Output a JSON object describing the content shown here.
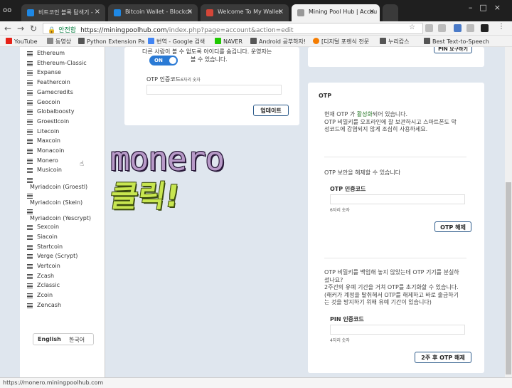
{
  "browser": {
    "tabs": [
      {
        "title": "비트코인 블록 탐색기 -",
        "color": "#1e88e5"
      },
      {
        "title": "Bitcoin Wallet - Blockch",
        "color": "#1e88e5"
      },
      {
        "title": "Welcome To My Wallet",
        "color": "#d44638"
      },
      {
        "title": "Mining Pool Hub | Accou",
        "color": "#999999"
      }
    ],
    "secure_label": "안전함",
    "url_host": "https://miningpoolhub.com",
    "url_path": "/index.php?page=account&action=edit",
    "bookmarks": [
      {
        "label": "YouTube",
        "color": "#e62117"
      },
      {
        "label": "동영상",
        "color": "#888888"
      },
      {
        "label": "Python Extension Pa",
        "color": "#555555"
      },
      {
        "label": "번역 - Google 검색",
        "color": "#4285f4"
      },
      {
        "label": "NAVER",
        "color": "#1ec800"
      },
      {
        "label": "Android 공부하자!",
        "color": "#555555"
      },
      {
        "label": "[디지털 포렌식 전문",
        "color": "#f57c00"
      },
      {
        "label": "누리캅스",
        "color": "#555555"
      },
      {
        "label": "Best Text-to-Speech",
        "color": "#555555"
      }
    ]
  },
  "sidebar": {
    "coins": [
      "Ethereum",
      "Ethereum-Classic",
      "Expanse",
      "Feathercoin",
      "Gamecredits",
      "Geocoin",
      "Globalboosty",
      "Groestlcoin",
      "Litecoin",
      "Maxcoin",
      "Monacoin",
      "Monero",
      "Musicoin",
      "Myriadcoin (Groestl)",
      "Myriadcoin (Skein)",
      "Myriadcoin (Yescrypt)",
      "Sexcoin",
      "Siacoin",
      "Startcoin",
      "Verge (Scrypt)",
      "Vertcoin",
      "Zcash",
      "Zclassic",
      "Zcoin",
      "Zencash"
    ],
    "lang_en": "English",
    "lang_ko": "한국어"
  },
  "left_panel": {
    "top_text_1": "다른 사람이 볼 수 없도록 아이디를 숨깁니다. 운영자는",
    "top_text_2": "볼 수 있습니다.",
    "toggle": "ON",
    "otp_label": "OTP 인증코드",
    "otp_hint": "6자리 숫자",
    "update_button": "업데이트"
  },
  "right_panel": {
    "top_button": "PIN 요구하기",
    "section_title": "OTP",
    "status_pre": "현재 OTP 가",
    "status_em": "활성화",
    "status_post": "되어 있습니다.",
    "status_line2": "OTP 비밀키를 오프라인에 잘 보관하시고 스마트폰도 악",
    "status_line3": "성코드에 감염되지 않게 조심히 사용하세요.",
    "disable_text": "OTP 보안을 해제할 수 있습니다",
    "disable_label": "OTP 인증코드",
    "disable_hint": "6자리 숫자",
    "disable_button": "OTP 해제",
    "reset_line1": "OTP 비밀키를 백업해 놓지 않았는데 OTP 기기를 분실하",
    "reset_line2": "셨나요?",
    "reset_line3": "2주간의 유예 기간을 거쳐 OTP를 초기화할 수 있습니다.",
    "reset_line4": "(해커가 계정을 탈취해서 OTP를 해제하고 바로 출금하기",
    "reset_line5": "는 것을 방지하기 위해 유예 기간이 있습니다)",
    "pin_label": "PIN 인증코드",
    "pin_hint": "4자리 숫자",
    "reset_button": "2주 후 OTP 해제"
  },
  "overlay": {
    "word": "monero",
    "click": "클릭!"
  },
  "status_bar": "https://monero.miningpoolhub.com"
}
